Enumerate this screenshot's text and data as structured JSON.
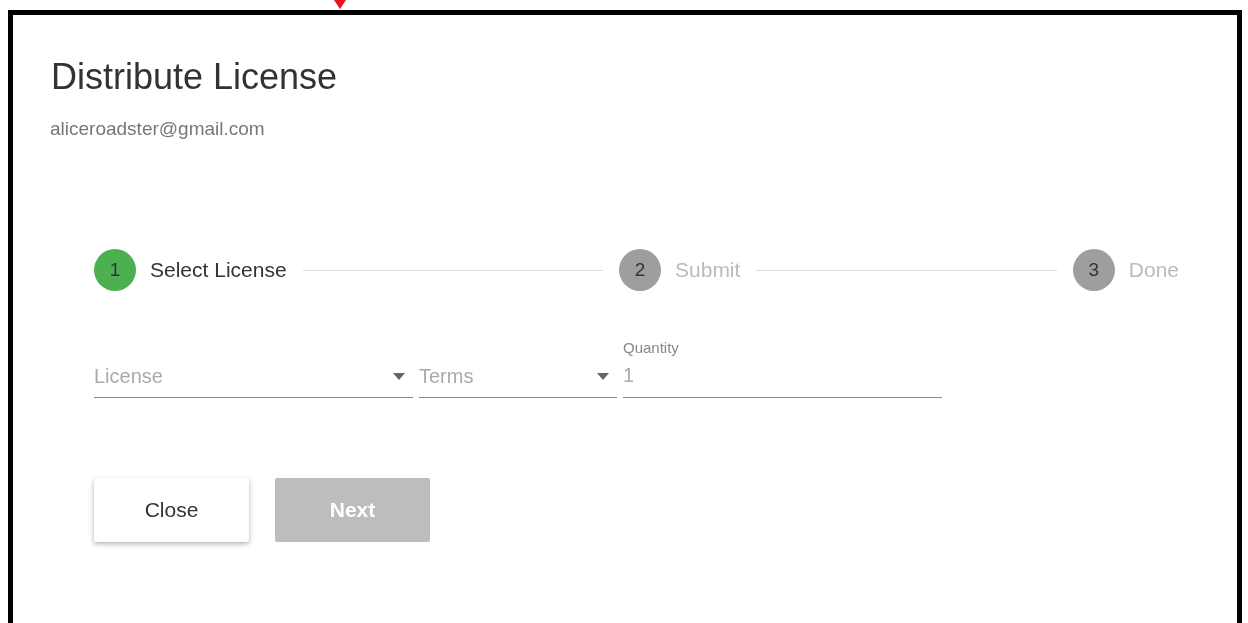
{
  "dialog": {
    "title": "Distribute License",
    "subtitle": "aliceroadster@gmail.com"
  },
  "steps": [
    {
      "number": "1",
      "label": "Select License",
      "active": true
    },
    {
      "number": "2",
      "label": "Submit",
      "active": false
    },
    {
      "number": "3",
      "label": "Done",
      "active": false
    }
  ],
  "fields": [
    {
      "kind": "select",
      "placeholder": "License"
    },
    {
      "kind": "select",
      "placeholder": "Terms"
    },
    {
      "kind": "text",
      "label": "Quantity",
      "value": "1"
    }
  ],
  "buttons": [
    {
      "label": "Close",
      "disabled": false
    },
    {
      "label": "Next",
      "disabled": true
    }
  ]
}
